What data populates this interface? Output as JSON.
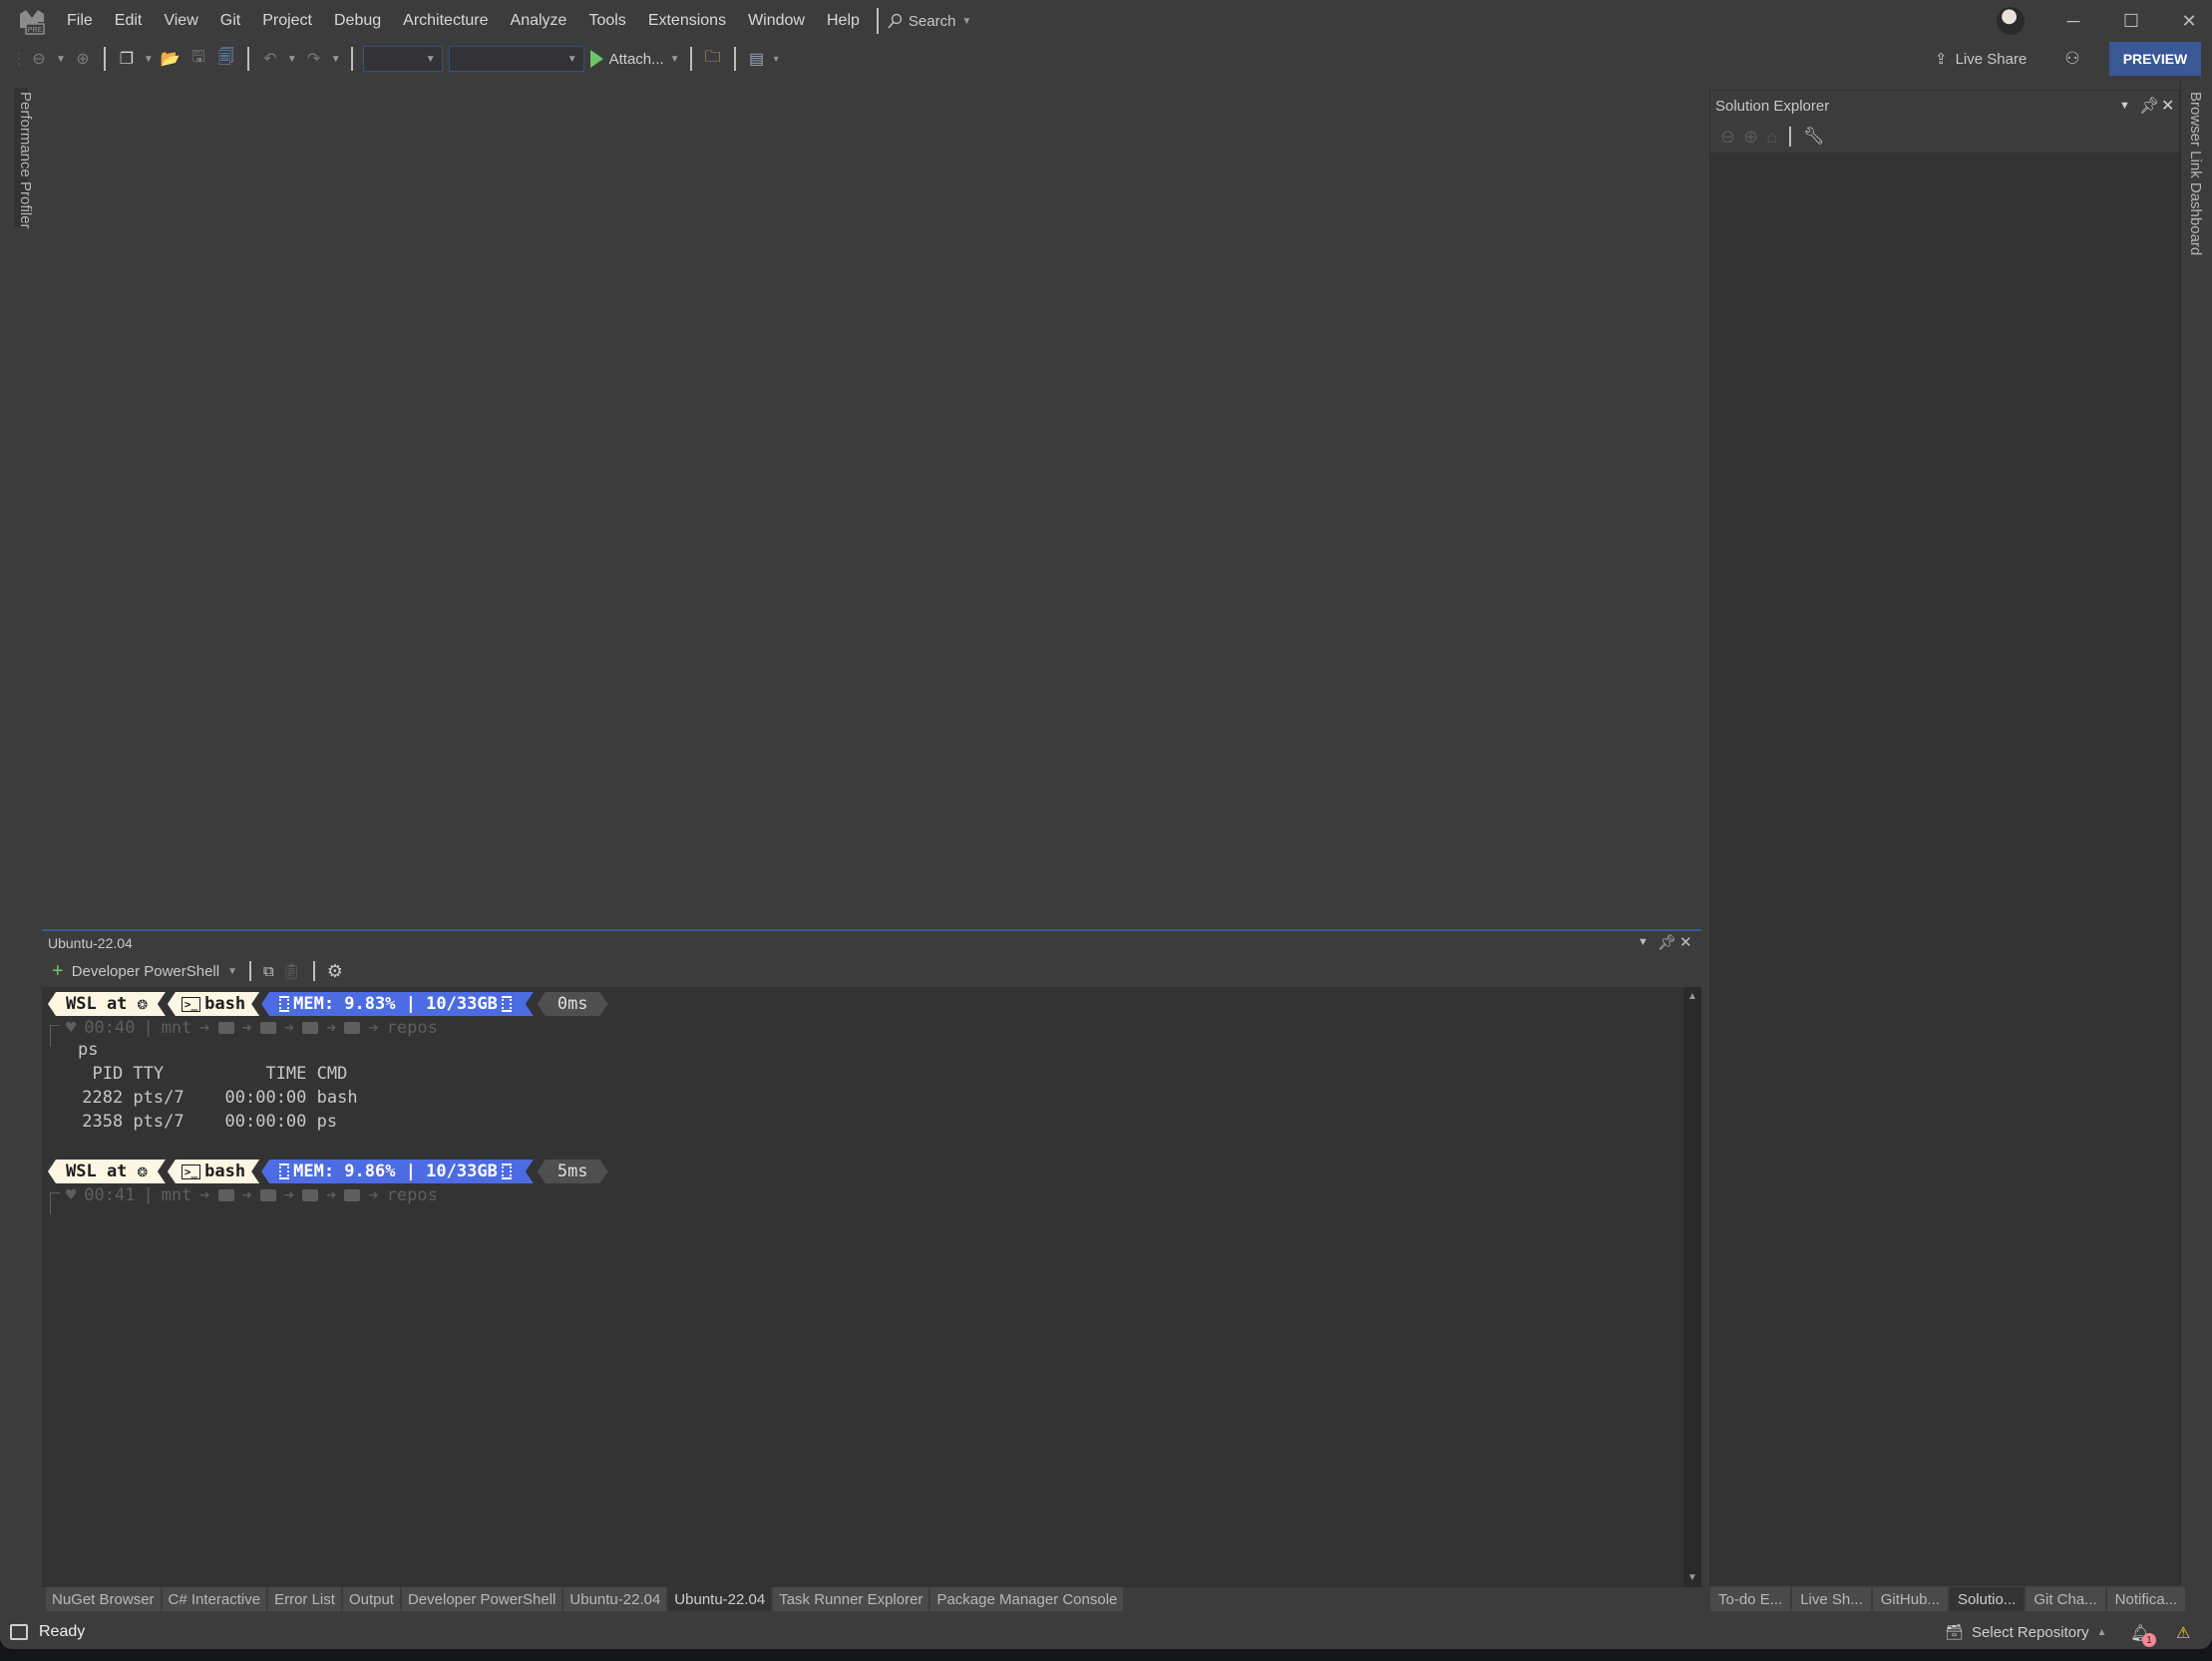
{
  "titlebar": {
    "logo_badge": "PRE",
    "menu": [
      "File",
      "Edit",
      "View",
      "Git",
      "Project",
      "Debug",
      "Architecture",
      "Analyze",
      "Tools",
      "Extensions",
      "Window",
      "Help"
    ],
    "search_label": "Search",
    "window_controls": [
      "minimize-icon",
      "maximize-icon",
      "close-icon"
    ]
  },
  "toolbar": {
    "attach_label": "Attach...",
    "live_share_label": "Live Share",
    "preview_label": "PREVIEW",
    "config_combo_value": "",
    "platform_combo_value": ""
  },
  "side_tabs": {
    "left": "Performance Profiler",
    "right": "Browser Link Dashboard"
  },
  "terminal": {
    "title": "Ubuntu-22.04",
    "shell_selector": "Developer PowerShell",
    "prompts": [
      {
        "host": "WSL at",
        "shell": "bash",
        "mem": "MEM: 9.83% | 10/33GB",
        "duration": "0ms",
        "time": "00:40",
        "path_start": "mnt",
        "path_end": "repos"
      },
      {
        "host": "WSL at",
        "shell": "bash",
        "mem": "MEM: 9.86% | 10/33GB",
        "duration": "5ms",
        "time": "00:41",
        "path_start": "mnt",
        "path_end": "repos"
      }
    ],
    "command": "ps",
    "output_lines": [
      "  PID TTY          TIME CMD",
      " 2282 pts/7    00:00:00 bash",
      " 2358 pts/7    00:00:00 ps"
    ]
  },
  "solution_explorer": {
    "title": "Solution Explorer"
  },
  "bottom_tabs_left": [
    {
      "label": "NuGet Browser",
      "active": false
    },
    {
      "label": "C# Interactive",
      "active": false
    },
    {
      "label": "Error List",
      "active": false
    },
    {
      "label": "Output",
      "active": false
    },
    {
      "label": "Developer PowerShell",
      "active": false
    },
    {
      "label": "Ubuntu-22.04",
      "active": false
    },
    {
      "label": "Ubuntu-22.04",
      "active": true
    },
    {
      "label": "Task Runner Explorer",
      "active": false
    },
    {
      "label": "Package Manager Console",
      "active": false
    }
  ],
  "bottom_tabs_right": [
    {
      "label": "To-do E...",
      "active": false
    },
    {
      "label": "Live Sh...",
      "active": false
    },
    {
      "label": "GitHub...",
      "active": false
    },
    {
      "label": "Solutio...",
      "active": true
    },
    {
      "label": "Git Cha...",
      "active": false
    },
    {
      "label": "Notifica...",
      "active": false
    }
  ],
  "statusbar": {
    "ready": "Ready",
    "select_repository": "Select Repository",
    "notification_count": "1"
  },
  "colors": {
    "accent": "#3a5896",
    "mem_segment": "#4d6ce3",
    "prompt_light": "#fdf6e3",
    "run_green": "#6cc56c"
  }
}
